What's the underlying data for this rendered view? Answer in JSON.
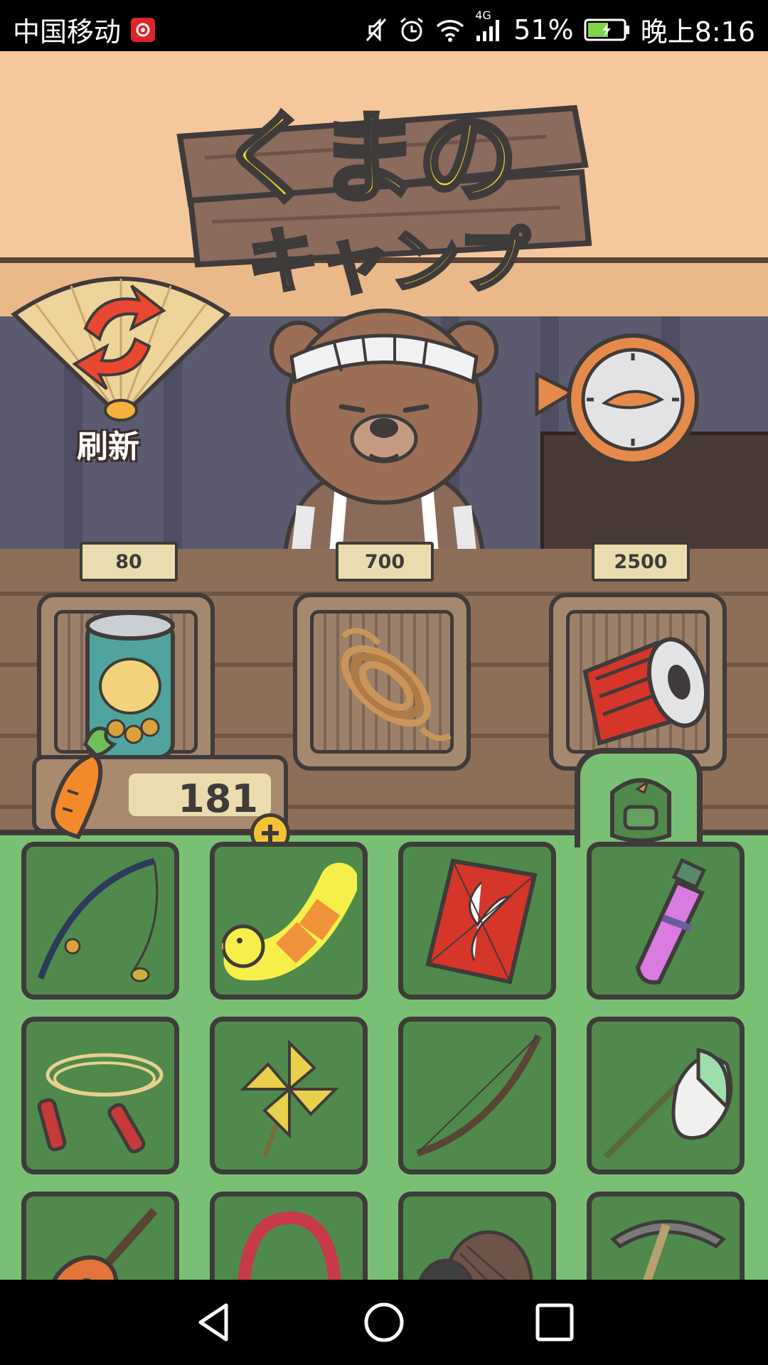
{
  "status_bar": {
    "carrier": "中国移动",
    "network": "4G",
    "battery_percent": "51%",
    "time": "晚上8:16",
    "icons": [
      "netease-music-icon",
      "mute-icon",
      "alarm-icon",
      "wifi-icon",
      "signal-icon",
      "battery-icon"
    ]
  },
  "header": {
    "title_line1": "くまの",
    "title_line2": "キャンプ"
  },
  "shop": {
    "refresh_label": "刷新",
    "items": [
      {
        "price": "80",
        "item": "beans-can"
      },
      {
        "price": "700",
        "item": "rope"
      },
      {
        "price": "2500",
        "item": "lantern"
      }
    ]
  },
  "wallet": {
    "carrots": "181"
  },
  "inventory": {
    "items": [
      "fishing-rod",
      "duck-float",
      "kite",
      "potion-vial",
      "jump-rope",
      "pinwheel",
      "bow",
      "bug-net",
      "ukulele",
      "headphones",
      "pinecone-hat",
      "pickaxe"
    ]
  },
  "colors": {
    "panel_green": "#7ac074",
    "slot_green": "#4f8a4c",
    "title_yellow": "#f6d52b",
    "wood": "#8c6e59"
  }
}
